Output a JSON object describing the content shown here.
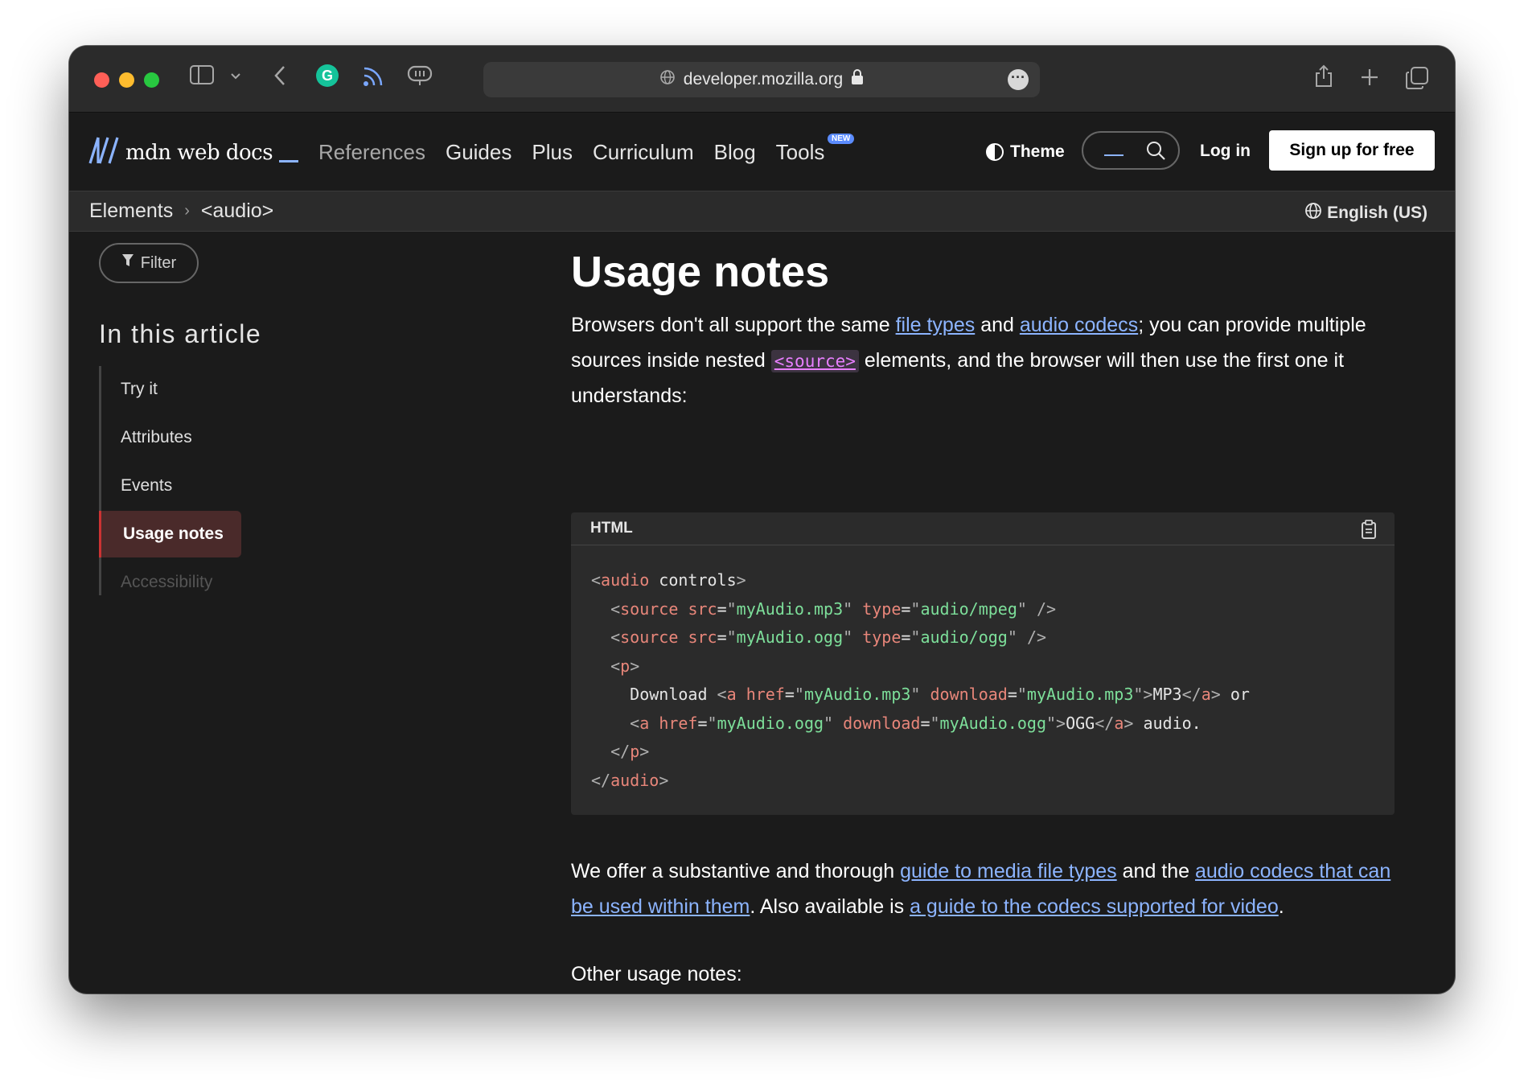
{
  "browser": {
    "url": "developer.mozilla.org"
  },
  "header": {
    "logo_text": "mdn web docs",
    "nav": [
      "References",
      "Guides",
      "Plus",
      "Curriculum",
      "Blog",
      "Tools"
    ],
    "new_badge": "NEW",
    "theme_label": "Theme",
    "login_label": "Log in",
    "signup_label": "Sign up for free"
  },
  "breadcrumb": {
    "items": [
      "Elements",
      "<audio>"
    ],
    "language": "English (US)"
  },
  "sidebar": {
    "filter_label": "Filter",
    "toc_title": "In this article",
    "items": [
      "Try it",
      "Attributes",
      "Events",
      "Usage notes",
      "Accessibility"
    ],
    "active_index": 3
  },
  "main": {
    "heading": "Usage notes",
    "p1": {
      "t1": "Browsers don't all support the same ",
      "link1": "file types",
      "t2": " and ",
      "link2": "audio codecs",
      "t3": "; you can provide multiple sources inside nested ",
      "code": "<source>",
      "t4": " elements, and the browser will then use the first one it understands:"
    },
    "code": {
      "language": "HTML",
      "lines": [
        "<audio controls>",
        "  <source src=\"myAudio.mp3\" type=\"audio/mpeg\" />",
        "  <source src=\"myAudio.ogg\" type=\"audio/ogg\" />",
        "  <p>",
        "    Download <a href=\"myAudio.mp3\" download=\"myAudio.mp3\">MP3</a> or",
        "    <a href=\"myAudio.ogg\" download=\"myAudio.ogg\">OGG</a> audio.",
        "  </p>",
        "</audio>"
      ]
    },
    "p2": {
      "t1": "We offer a substantive and thorough ",
      "link1": "guide to media file types",
      "t2": " and the ",
      "link2": "audio codecs that can be used within them",
      "t3": ". Also available is ",
      "link3": "a guide to the codecs supported for video",
      "t4": "."
    },
    "p3": "Other usage notes:"
  }
}
